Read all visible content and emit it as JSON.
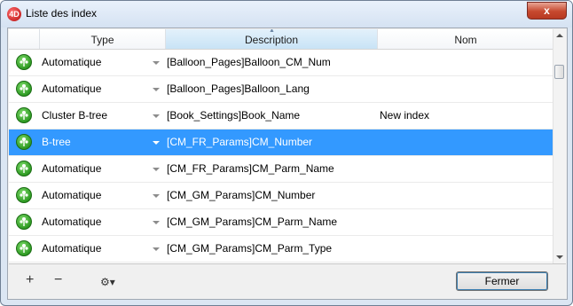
{
  "window": {
    "title": "Liste des index",
    "app_icon_text": "4D",
    "close_label": "x"
  },
  "table": {
    "columns": {
      "icon": "",
      "type": "Type",
      "description": "Description",
      "nom": "Nom"
    },
    "sorted_column": "Description",
    "rows": [
      {
        "type": "Automatique",
        "description": "[Balloon_Pages]Balloon_CM_Num",
        "nom": ""
      },
      {
        "type": "Automatique",
        "description": "[Balloon_Pages]Balloon_Lang",
        "nom": ""
      },
      {
        "type": "Cluster B-tree",
        "description": "[Book_Settings]Book_Name",
        "nom": "New index"
      },
      {
        "type": "B-tree",
        "description": "[CM_FR_Params]CM_Number",
        "nom": "",
        "selected": true
      },
      {
        "type": "Automatique",
        "description": "[CM_FR_Params]CM_Parm_Name",
        "nom": ""
      },
      {
        "type": "Automatique",
        "description": "[CM_GM_Params]CM_Number",
        "nom": ""
      },
      {
        "type": "Automatique",
        "description": "[CM_GM_Params]CM_Parm_Name",
        "nom": ""
      },
      {
        "type": "Automatique",
        "description": "[CM_GM_Params]CM_Parm_Type",
        "nom": ""
      }
    ]
  },
  "footer": {
    "add_label": "+",
    "remove_label": "−",
    "gear_label": "⚙▾",
    "close_button_label": "Fermer"
  },
  "colors": {
    "selection": "#3399ff",
    "index_icon": "#2e9a23"
  },
  "icons": {
    "row_icon": "index-tree-icon"
  }
}
